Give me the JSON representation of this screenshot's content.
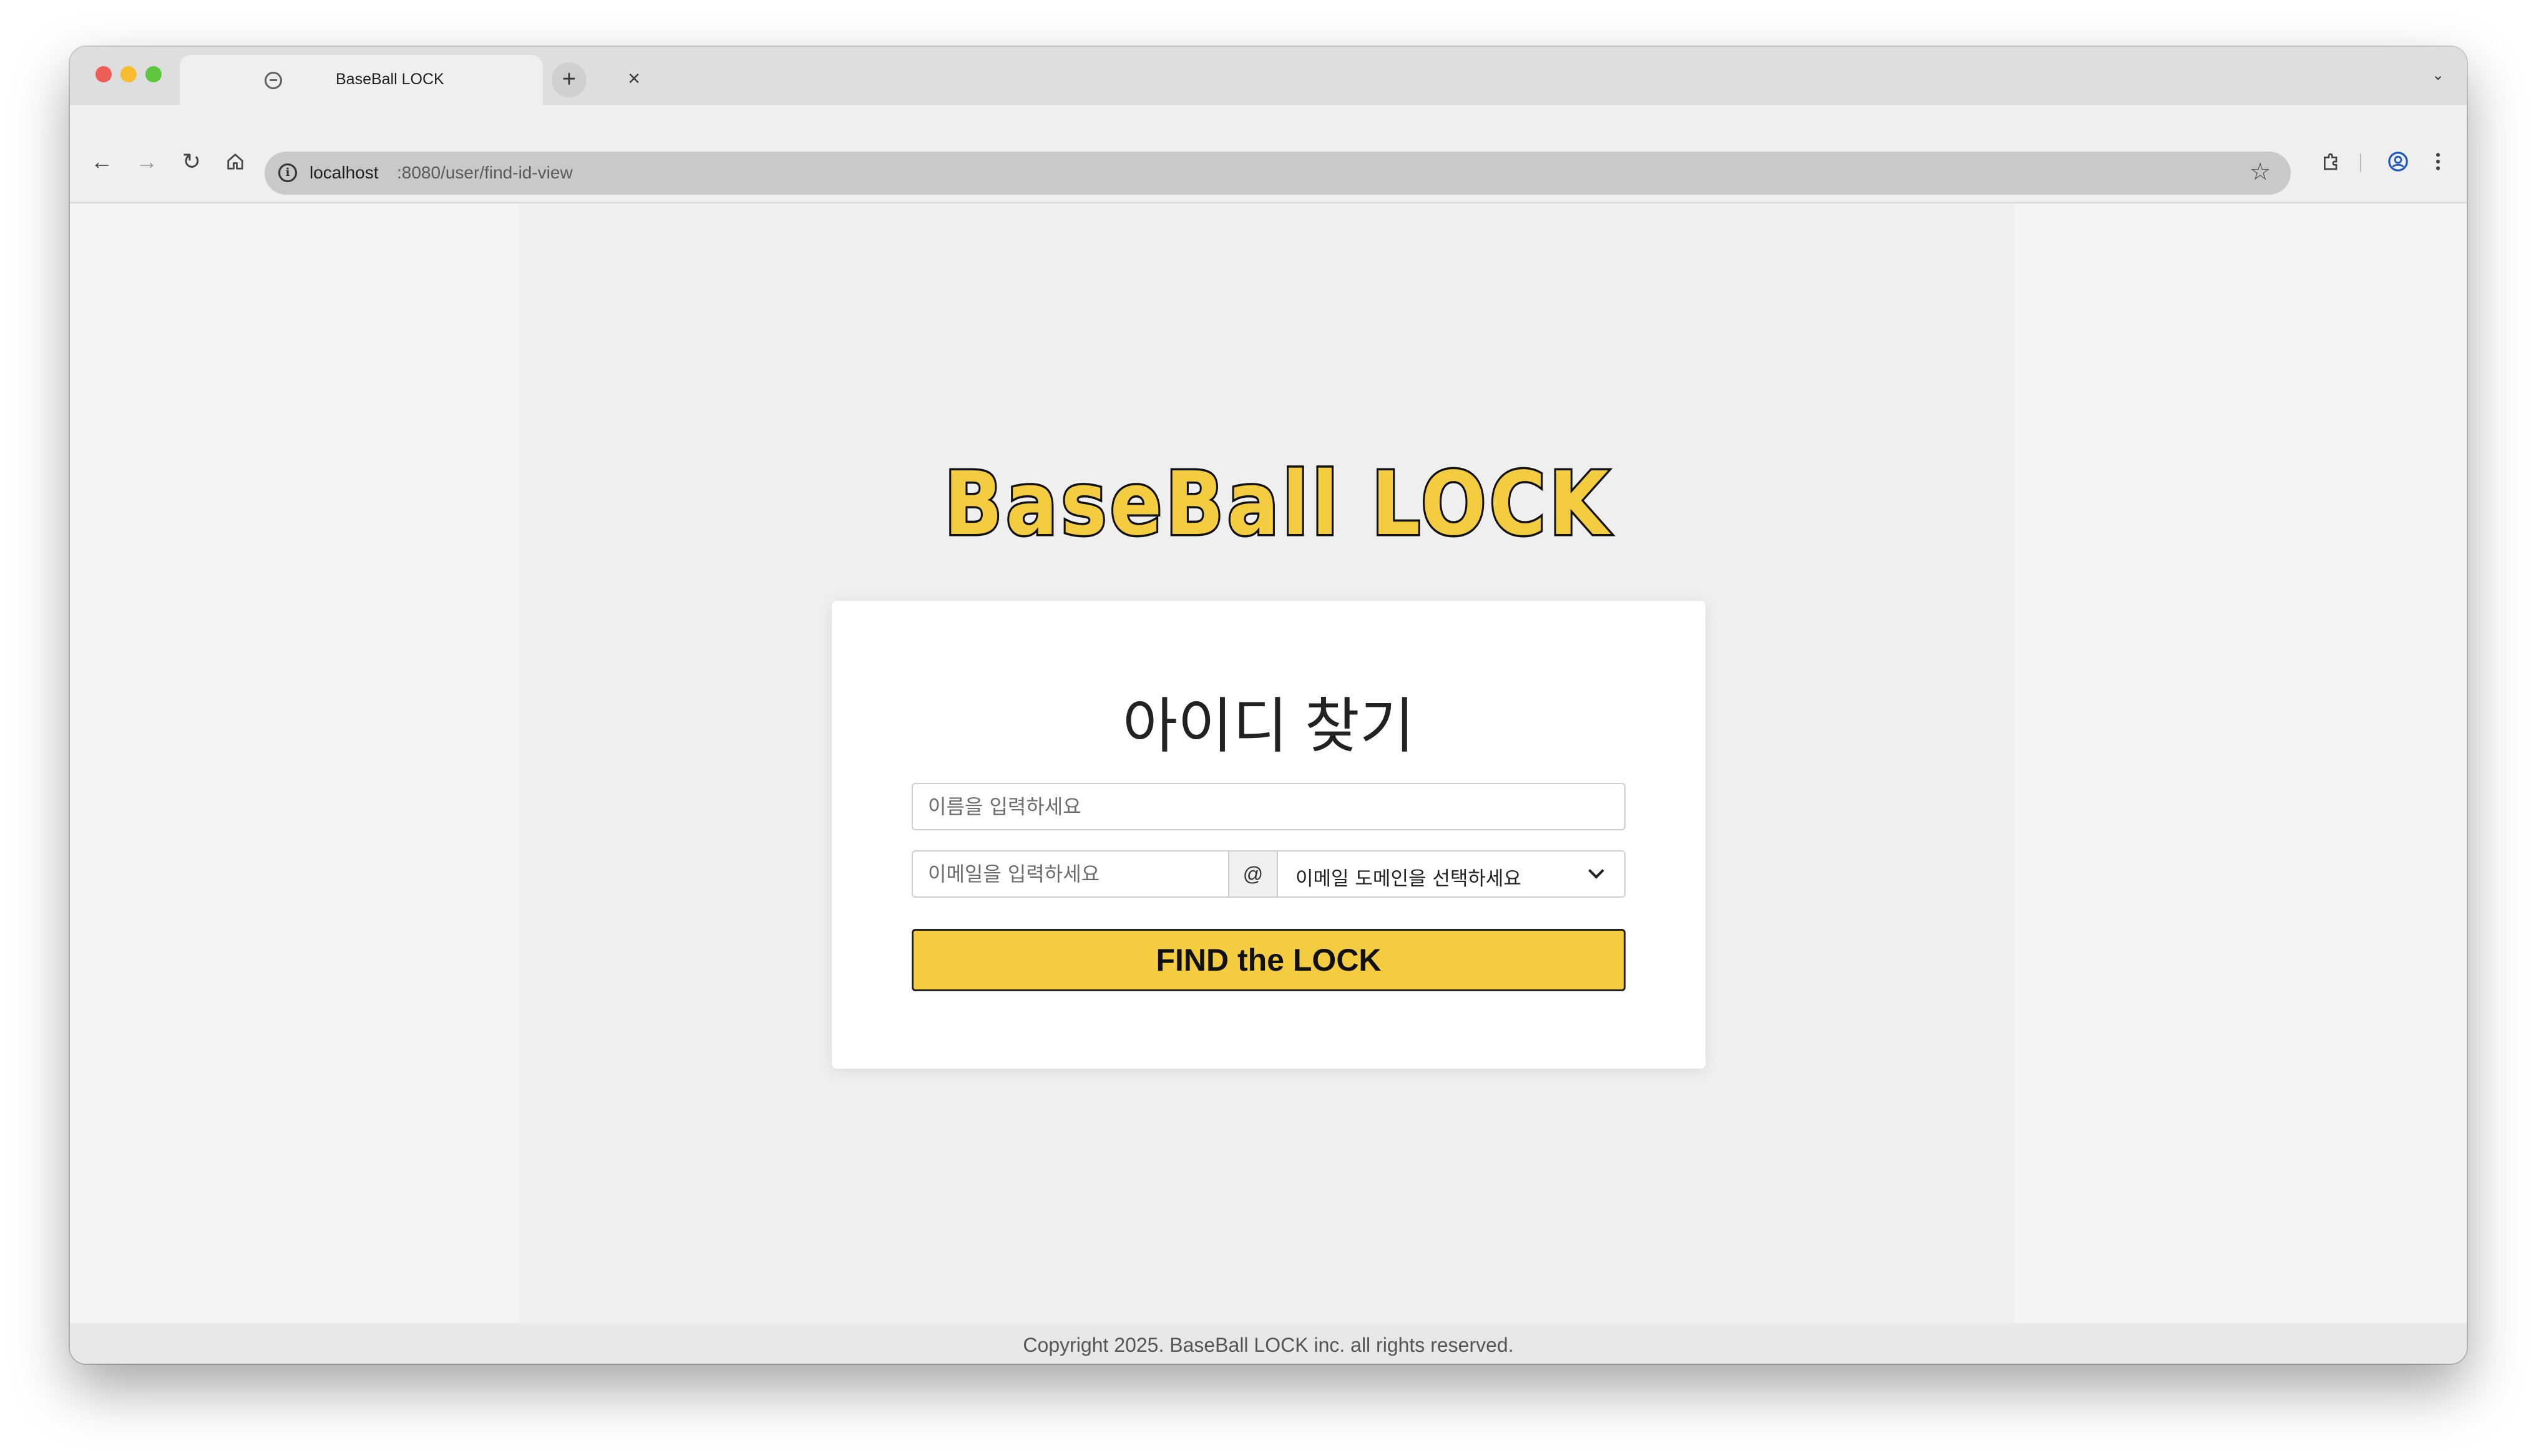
{
  "browser": {
    "tab_title": "BaseBall LOCK",
    "url_host": "localhost",
    "url_path": ":8080/user/find-id-view"
  },
  "page": {
    "logo_text": "BaseBall LOCK",
    "title": "아이디 찾기",
    "name_placeholder": "이름을 입력하세요",
    "email_placeholder": "이메일을 입력하세요",
    "at_sign": "@",
    "domain_select_value": "이메일 도메인을 선택하세요",
    "submit_label": "FIND the LOCK",
    "footer": "Copyright 2025. BaseBall LOCK inc. all rights reserved."
  },
  "colors": {
    "brand_yellow": "#f3cd3f",
    "button_border": "#222222"
  }
}
